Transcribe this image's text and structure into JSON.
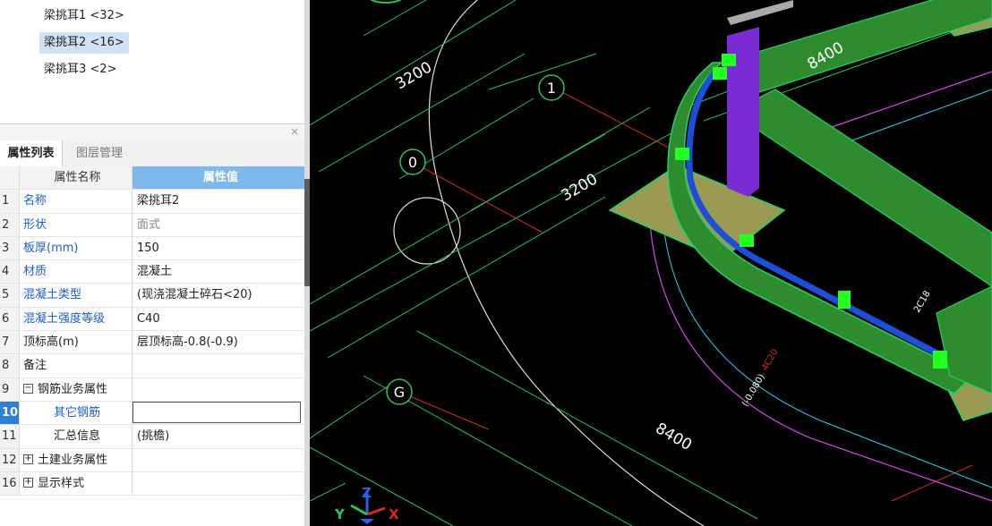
{
  "tree": {
    "items": [
      {
        "label": "梁挑耳1 <32>",
        "selected": false
      },
      {
        "label": "梁挑耳2 <16>",
        "selected": true
      },
      {
        "label": "梁挑耳3 <2>",
        "selected": false
      }
    ]
  },
  "panel": {
    "close_label": "×",
    "tabs": [
      "属性列表",
      "图层管理"
    ],
    "columns": {
      "name": "属性名称",
      "value": "属性值"
    },
    "rows": [
      {
        "num": "1",
        "name": "名称",
        "value": "梁挑耳2"
      },
      {
        "num": "2",
        "name": "形状",
        "value": "面式"
      },
      {
        "num": "3",
        "name": "板厚(mm)",
        "value": "150"
      },
      {
        "num": "4",
        "name": "材质",
        "value": "混凝土"
      },
      {
        "num": "5",
        "name": "混凝土类型",
        "value": "(现浇混凝土碎石<20)"
      },
      {
        "num": "6",
        "name": "混凝土强度等级",
        "value": "C40"
      },
      {
        "num": "7",
        "name": "顶标高(m)",
        "value": "层顶标高-0.8(-0.9)"
      },
      {
        "num": "8",
        "name": "备注",
        "value": ""
      },
      {
        "num": "9",
        "name": "钢筋业务属性",
        "value": "",
        "expander": "−"
      },
      {
        "num": "10",
        "name": "其它钢筋",
        "value": ""
      },
      {
        "num": "11",
        "name": "汇总信息",
        "value": "(挑檐)"
      },
      {
        "num": "12",
        "name": "土建业务属性",
        "value": "",
        "expander": "+"
      },
      {
        "num": "16",
        "name": "显示样式",
        "value": "",
        "expander": "+"
      }
    ]
  },
  "viewport": {
    "axis_labels": {
      "a": "1",
      "b": "0",
      "c": "G"
    },
    "dimensions": {
      "d1": "3200",
      "d2": "8400",
      "d3": "3200",
      "d4": "8400"
    },
    "annotations": {
      "n1": "4C20",
      "n2": "(-0.080)",
      "n3": "2C18"
    },
    "triad": {
      "x": "X",
      "y": "Y",
      "z": "Z"
    }
  },
  "colors": {
    "selected_bg": "#cfe3f5",
    "header_value_bg": "#7fb8ec",
    "blue_label": "#1a5fd0",
    "beam_green": "#2e8b2e",
    "highlight_blue": "#1d4ed8",
    "column_purple": "#7b2bd4",
    "slab_khaki": "#9a9a55",
    "grid_green": "#22c55e"
  }
}
